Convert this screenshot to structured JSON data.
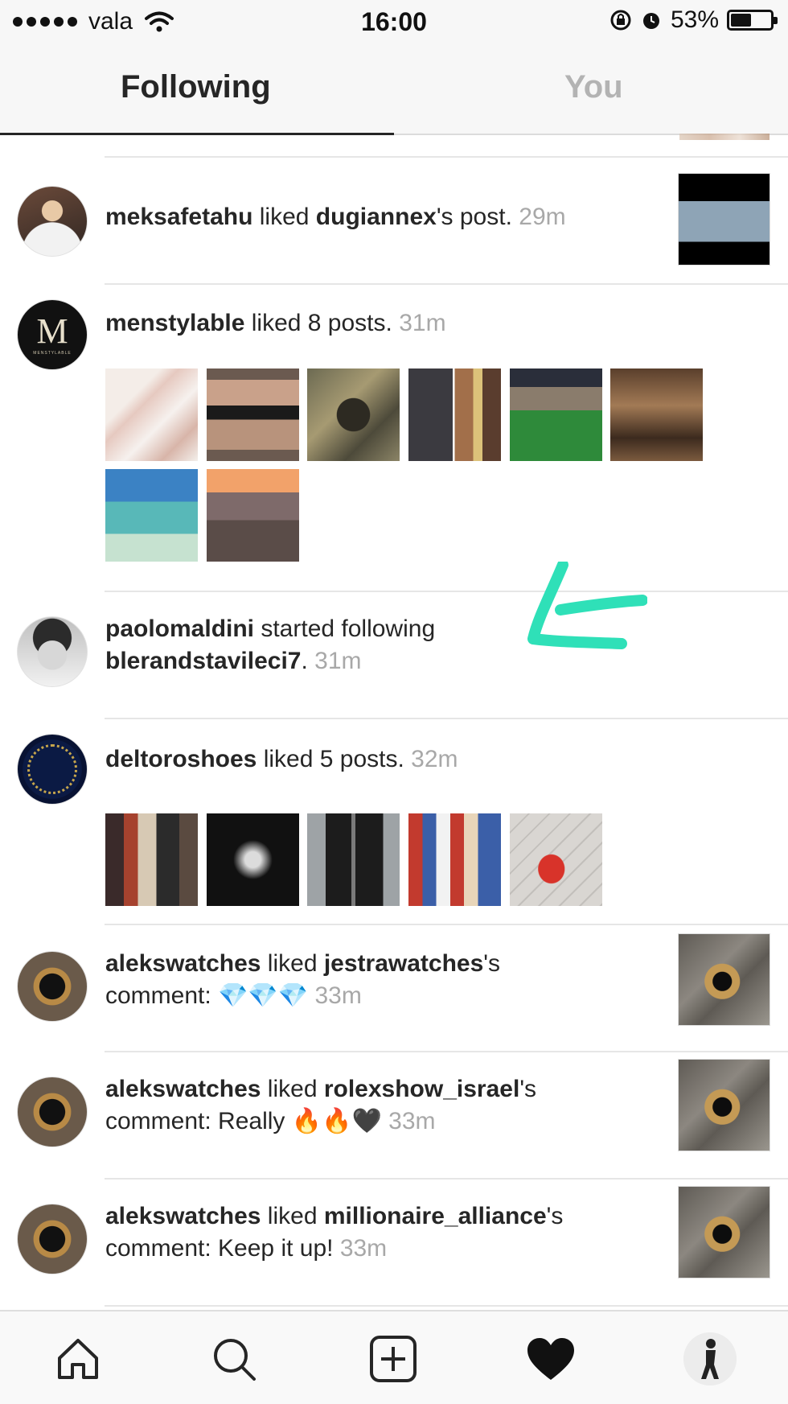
{
  "status_bar": {
    "carrier": "vala",
    "time": "16:00",
    "battery": "53%",
    "battery_level": 0.53
  },
  "tabs": [
    {
      "label": "Following",
      "active": true
    },
    {
      "label": "You",
      "active": false
    }
  ],
  "feed": [
    {
      "user": "meksafetahu",
      "action": " liked ",
      "target": "dugiannex",
      "suffix": "'s post.",
      "time": "29m"
    },
    {
      "user": "menstylable",
      "action": " liked 8 posts.",
      "time": "31m",
      "avatar_text": "M",
      "avatar_caption": "MENSTYLABLE",
      "thumb_count": 8
    },
    {
      "user": "paolomaldini",
      "action": " started following",
      "target": "blerandstavileci7",
      "suffix": ".",
      "time": "31m"
    },
    {
      "user": "deltoroshoes",
      "action": " liked 5 posts.",
      "time": "32m",
      "thumb_count": 5
    },
    {
      "user": "alekswatches",
      "action": " liked ",
      "target": "jestrawatches",
      "suffix": "'s",
      "line2_prefix": "comment: ",
      "emojis": [
        "💎",
        "💎",
        "💎"
      ],
      "time": "33m"
    },
    {
      "user": "alekswatches",
      "action": " liked ",
      "target": "rolexshow_israel",
      "suffix": "'s",
      "line2_prefix": "comment: Really ",
      "emojis": [
        "🔥",
        "🔥",
        "🖤"
      ],
      "time": "33m"
    },
    {
      "user": "alekswatches",
      "action": " liked ",
      "target": "millionaire_alliance",
      "suffix": "'s",
      "line2_prefix": "comment: Keep it up! ",
      "time": "33m"
    }
  ],
  "colors": {
    "annotation_arrow": "#2fe0b8",
    "time_text": "#a8a8a8",
    "inactive_tab": "#b3b3b3"
  },
  "nav": [
    "home-icon",
    "search-icon",
    "add-icon",
    "heart-icon",
    "profile-avatar"
  ]
}
